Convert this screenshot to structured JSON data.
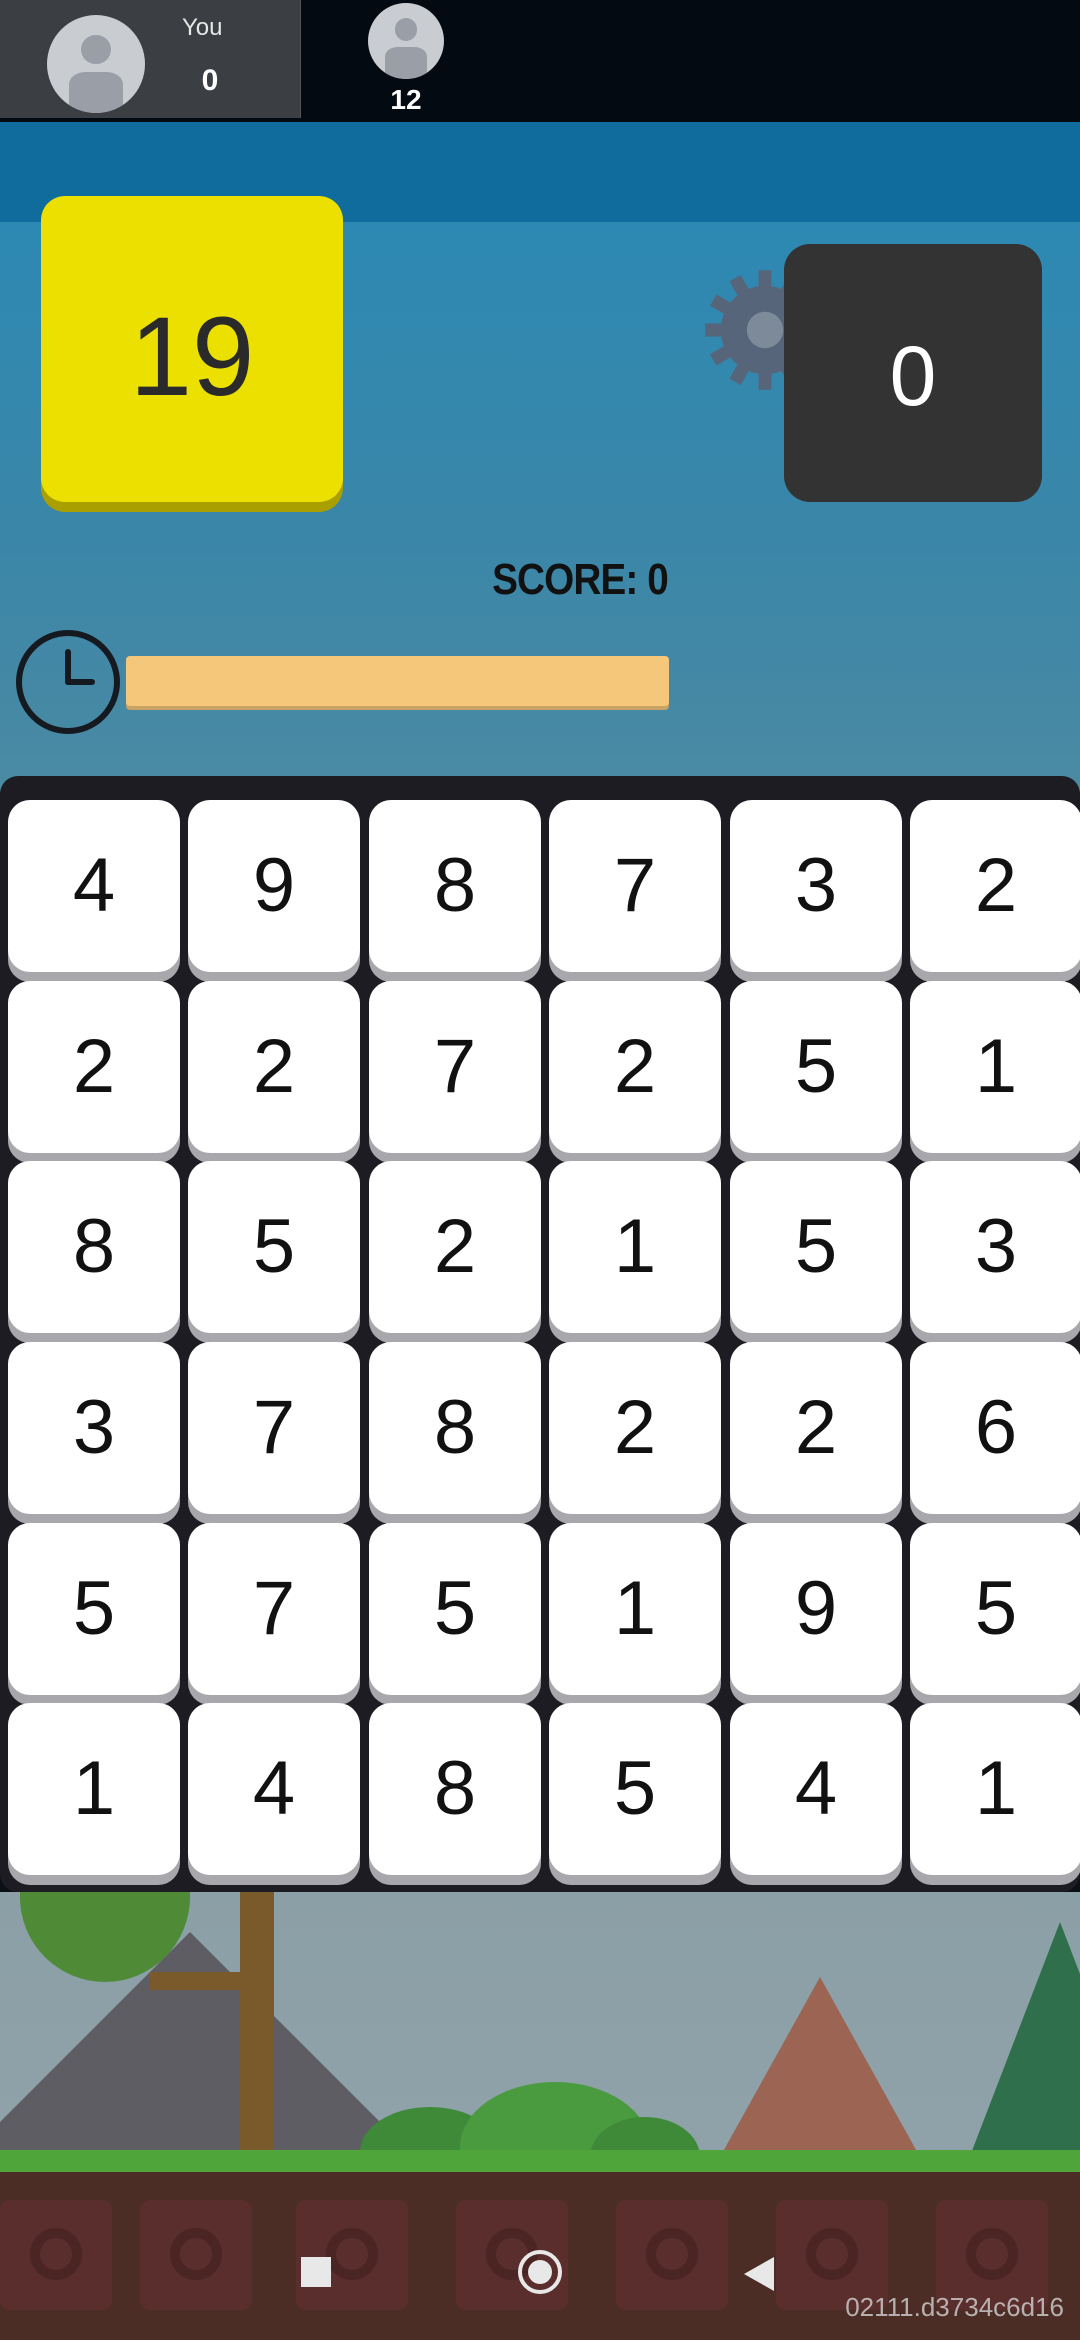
{
  "players": {
    "you": {
      "name": "You",
      "score": "0"
    },
    "opponent": {
      "score": "12"
    }
  },
  "game": {
    "target_value": "19",
    "current_sum": "0",
    "score_text": "SCORE: 0",
    "timer_fraction": 0.97
  },
  "grid": [
    [
      "4",
      "9",
      "8",
      "7",
      "3",
      "2"
    ],
    [
      "2",
      "2",
      "7",
      "2",
      "5",
      "1"
    ],
    [
      "8",
      "5",
      "2",
      "1",
      "5",
      "3"
    ],
    [
      "3",
      "7",
      "8",
      "2",
      "2",
      "6"
    ],
    [
      "5",
      "7",
      "5",
      "1",
      "9",
      "5"
    ],
    [
      "1",
      "4",
      "8",
      "5",
      "4",
      "1"
    ]
  ],
  "colors": {
    "target_box": "#ebe000",
    "sum_box": "#333334",
    "timer": "#f5c77b",
    "board": "#1d1c22"
  },
  "system": {
    "build_text": "02111.d3734c6d16"
  }
}
